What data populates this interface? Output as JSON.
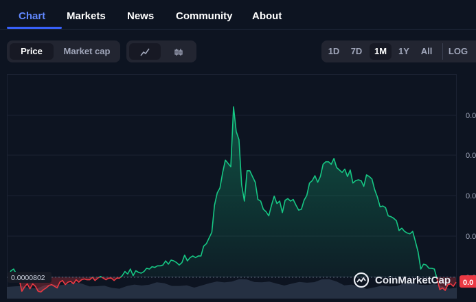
{
  "nav": {
    "tabs": [
      "Chart",
      "Markets",
      "News",
      "Community",
      "About"
    ],
    "active": "Chart"
  },
  "toolbar": {
    "metric_buttons": [
      "Price",
      "Market cap"
    ],
    "metric_selected": "Price",
    "chart_type_buttons": [
      {
        "name": "line-chart-icon",
        "glyph": "⟋"
      },
      {
        "name": "candlestick-icon",
        "glyph": "‖|"
      }
    ],
    "chart_type_selected": "line-chart-icon",
    "range_buttons": [
      "1D",
      "7D",
      "1M",
      "1Y",
      "All",
      "LOG"
    ],
    "range_selected": "1M"
  },
  "watermark": "CoinMarketCap",
  "colors": {
    "up": "#16c784",
    "down": "#ea3943",
    "brand_blue": "#3861fb"
  },
  "chart_data": {
    "type": "line",
    "reference_label": "0.0000802",
    "y_axis_labels": [
      "0.0",
      "0.0",
      "0.0",
      "0.0",
      "0.0",
      "0.0"
    ],
    "current_price_label": "0.0",
    "ylim": [
      7.76e-05,
      0.000105
    ],
    "baseline": 8.02e-05,
    "x": [
      0,
      1,
      2,
      3,
      4,
      5,
      6,
      7,
      8,
      9,
      10,
      11,
      12,
      13,
      14,
      15,
      16,
      17,
      18,
      19,
      20,
      21,
      22,
      23,
      24,
      25,
      26,
      27,
      28,
      29,
      30,
      31,
      32,
      33,
      34,
      35,
      36,
      37,
      38,
      39,
      40,
      41,
      42,
      43,
      44,
      45,
      46,
      47,
      48,
      49,
      50,
      51,
      52,
      53,
      54,
      55,
      56,
      57,
      58,
      59,
      60,
      61,
      62,
      63,
      64,
      65,
      66,
      67,
      68,
      69,
      70,
      71,
      72,
      73,
      74,
      75,
      76,
      77,
      78,
      79,
      80,
      81,
      82,
      83,
      84,
      85,
      86,
      87,
      88,
      89,
      90,
      91,
      92,
      93,
      94,
      95,
      96,
      97,
      98,
      99,
      100,
      101,
      102,
      103,
      104,
      105,
      106,
      107,
      108,
      109,
      110,
      111,
      112,
      113,
      114,
      115,
      116,
      117,
      118,
      119,
      120,
      121,
      122,
      123,
      124,
      125,
      126,
      127,
      128,
      129,
      130,
      131,
      132,
      133,
      134,
      135,
      136,
      137,
      138,
      139,
      140,
      141,
      142,
      143,
      144,
      145,
      146,
      147,
      148,
      149,
      150,
      151,
      152,
      153,
      154,
      155,
      156,
      157,
      158,
      159,
      160,
      161,
      162,
      163,
      164,
      165
    ],
    "y": [
      8.02e-05,
      8.1e-05,
      8.12e-05,
      8.06e-05,
      8e-05,
      7.85e-05,
      7.9e-05,
      7.94e-05,
      7.88e-05,
      7.94e-05,
      7.91e-05,
      7.85e-05,
      7.84e-05,
      7.87e-05,
      7.89e-05,
      7.92e-05,
      7.93e-05,
      7.91e-05,
      7.89e-05,
      7.96e-05,
      7.98e-05,
      7.93e-05,
      7.96e-05,
      7.97e-05,
      7.94e-05,
      7.99e-05,
      7.96e-05,
      7.99e-05,
      8e-05,
      7.99e-05,
      7.99e-05,
      8.02e-05,
      7.98e-05,
      8.01e-05,
      8.03e-05,
      8.01e-05,
      7.99e-05,
      8.01e-05,
      8.01e-05,
      7.98e-05,
      8.01e-05,
      8.01e-05,
      8.04e-05,
      8.09e-05,
      8.06e-05,
      8.12e-05,
      8.04e-05,
      8.1e-05,
      8.08e-05,
      8.07e-05,
      8.09e-05,
      8.13e-05,
      8.12e-05,
      8.15e-05,
      8.14e-05,
      8.16e-05,
      8.16e-05,
      8.17e-05,
      8.22e-05,
      8.18e-05,
      8.23e-05,
      8.22e-05,
      8.2e-05,
      8.17e-05,
      8.2e-05,
      8.29e-05,
      8.22e-05,
      8.26e-05,
      8.28e-05,
      8.26e-05,
      8.28e-05,
      8.28e-05,
      8.4e-05,
      8.43e-05,
      8.5e-05,
      8.57e-05,
      8.9e-05,
      9.05e-05,
      9.11e-05,
      9.3e-05,
      9.45e-05,
      9.41e-05,
      9.37e-05,
      0.000101,
      9.8e-05,
      9.7e-05,
      9.15e-05,
      8.95e-05,
      9.32e-05,
      9.32e-05,
      9.25e-05,
      9.18e-05,
      8.97e-05,
      8.95e-05,
      8.85e-05,
      8.82e-05,
      8.77e-05,
      8.9e-05,
      9.01e-05,
      8.92e-05,
      8.95e-05,
      8.81e-05,
      8.96e-05,
      8.98e-05,
      8.95e-05,
      8.97e-05,
      8.9e-05,
      8.84e-05,
      8.85e-05,
      8.96e-05,
      9.02e-05,
      9.17e-05,
      9.2e-05,
      9.26e-05,
      9.18e-05,
      9.25e-05,
      9.4e-05,
      9.43e-05,
      9.43e-05,
      9.4e-05,
      9.47e-05,
      9.36e-05,
      9.33e-05,
      9.3e-05,
      9.34e-05,
      9.25e-05,
      9.33e-05,
      9.17e-05,
      9.2e-05,
      9.21e-05,
      9.2e-05,
      9.13e-05,
      9.27e-05,
      9.25e-05,
      9.22e-05,
      9.09e-05,
      9e-05,
      8.88e-05,
      8.89e-05,
      8.87e-05,
      8.77e-05,
      8.76e-05,
      8.74e-05,
      8.71e-05,
      8.59e-05,
      8.62e-05,
      8.58e-05,
      8.56e-05,
      8.55e-05,
      8.58e-05,
      8.46e-05,
      8.33e-05,
      8.12e-05,
      8.18e-05,
      8.17e-05,
      8.13e-05,
      8.13e-05,
      8.12e-05,
      8e-05,
      7.87e-05,
      7.89e-05,
      7.86e-05,
      7.93e-05,
      7.94e-05,
      7.91e-05,
      7.96e-05
    ]
  }
}
